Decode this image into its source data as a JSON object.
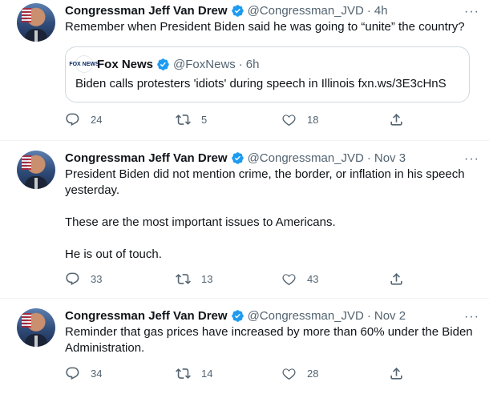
{
  "tweets": [
    {
      "author_name": "Congressman Jeff Van Drew",
      "handle": "@Congressman_JVD",
      "time": "4h",
      "text": "Remember when President Biden said he was going to “unite” the country?",
      "quote": {
        "logo_text": "FOX NEWS",
        "author_name": "Fox News",
        "handle": "@FoxNews",
        "time": "6h",
        "text": "Biden calls protesters 'idiots' during speech in Illinois fxn.ws/3E3cHnS"
      },
      "replies": "24",
      "retweets": "5",
      "likes": "18"
    },
    {
      "author_name": "Congressman Jeff Van Drew",
      "handle": "@Congressman_JVD",
      "time": "Nov 3",
      "text": "President Biden did not mention crime, the border, or inflation in his speech yesterday.\n\nThese are the most important issues to Americans.\n\nHe is out of touch.",
      "replies": "33",
      "retweets": "13",
      "likes": "43"
    },
    {
      "author_name": "Congressman Jeff Van Drew",
      "handle": "@Congressman_JVD",
      "time": "Nov 2",
      "text": "Reminder that gas prices have increased by more than 60% under the Biden Administration.",
      "replies": "34",
      "retweets": "14",
      "likes": "28"
    }
  ],
  "separator": "·",
  "more_label": "···",
  "colors": {
    "verified": "#1d9bf0",
    "secondary_text": "#536471",
    "divider": "#eff3f4"
  }
}
